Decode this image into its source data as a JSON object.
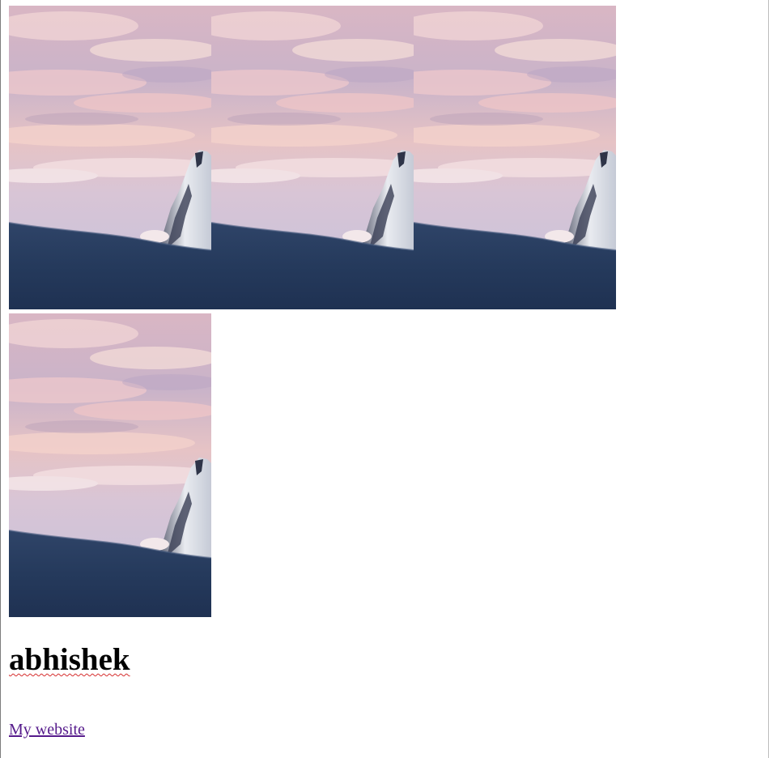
{
  "gallery": {
    "images": [
      {
        "alt": "mountain-sunset-photo"
      },
      {
        "alt": "mountain-sunset-photo"
      },
      {
        "alt": "mountain-sunset-photo"
      },
      {
        "alt": "mountain-sunset-photo"
      }
    ]
  },
  "heading": {
    "text": "abhishek"
  },
  "link": {
    "text": "My website"
  },
  "colors": {
    "link_visited": "#551a8b",
    "spellcheck_underline": "#d62d2d",
    "snow_dark": "#233656",
    "sky_pink": "#e8c7cd"
  }
}
